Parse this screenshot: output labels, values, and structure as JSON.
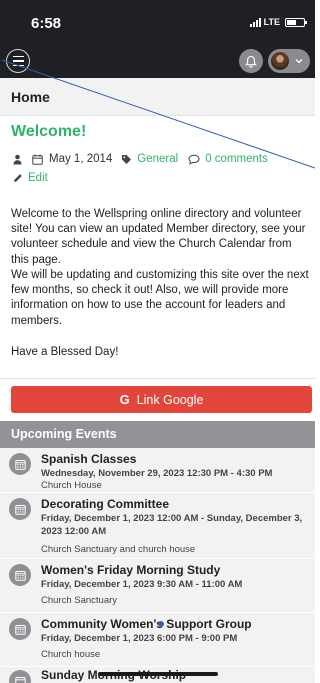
{
  "status_bar": {
    "time": "6:58",
    "network": "LTE"
  },
  "header": {
    "menu_icon": "hamburger-menu-icon",
    "bell_icon": "bell-icon",
    "avatar_icon": "user-avatar",
    "caret_icon": "chevron-down-icon"
  },
  "page": {
    "title": "Home"
  },
  "post": {
    "title": "Welcome!",
    "date": "May 1, 2014",
    "category": "General",
    "comments": "0 comments",
    "edit_label": "Edit",
    "paragraphs": [
      "Welcome to the Wellspring online directory and volunteer site! You can view an updated Member directory, see your volunteer schedule and view the Church Calendar from this page.",
      "We will be updating and customizing this site over the next few months, so check it out! Also, we will provide more information on how to use the account for leaders and members.",
      "Have a Blessed Day!"
    ]
  },
  "google_button": {
    "icon_letter": "G",
    "label": "Link Google"
  },
  "events": {
    "heading": "Upcoming Events",
    "items": [
      {
        "title": "Spanish Classes",
        "date": "Wednesday, November 29, 2023 12:30 PM - 4:30 PM",
        "location": "Church House"
      },
      {
        "title": "Decorating Committee",
        "date": "Friday, December 1, 2023 12:00 AM - Sunday, December 3, 2023 12:00 AM",
        "location": "Church Sanctuary and church house"
      },
      {
        "title": "Women's Friday Morning Study",
        "date": "Friday, December 1, 2023 9:30 AM - 11:00 AM",
        "location": "Church Sanctuary"
      },
      {
        "title": "Community Women's Support Group",
        "date": "Friday, December 1, 2023 6:00 PM - 9:00 PM",
        "location": "Church house"
      },
      {
        "title": "Sunday Morning Worship",
        "date": "",
        "location": ""
      }
    ]
  },
  "colors": {
    "accent_green": "#2fb36b",
    "google_red": "#e2463b",
    "header_dark": "#1f2024",
    "events_header": "#929397"
  }
}
